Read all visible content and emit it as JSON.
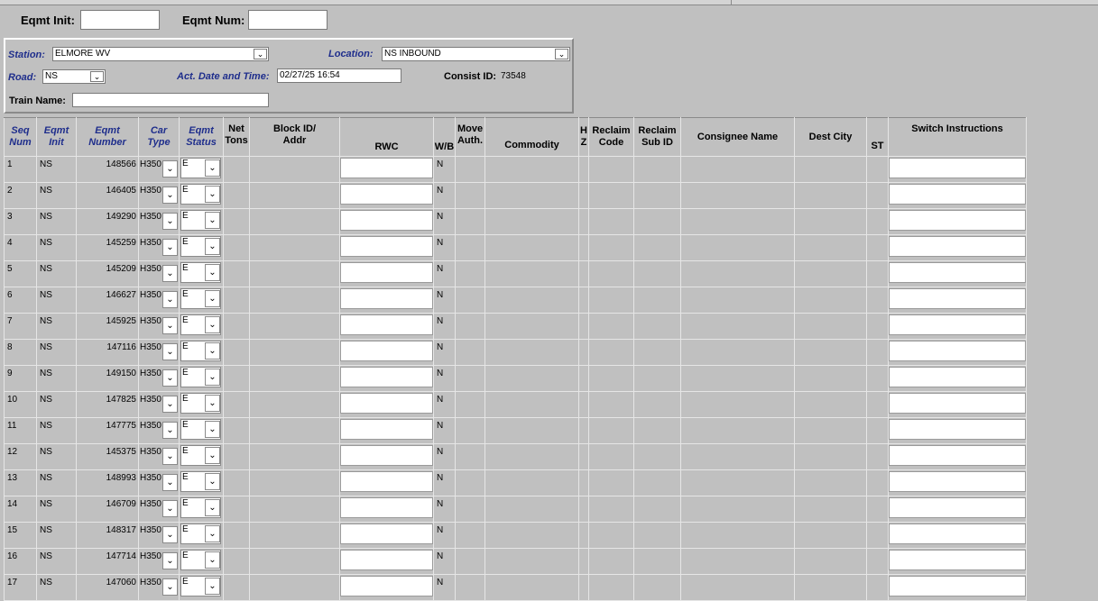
{
  "search": {
    "eqmt_init_label": "Eqmt Init:",
    "eqmt_init_value": "",
    "eqmt_num_label": "Eqmt Num:",
    "eqmt_num_value": ""
  },
  "header": {
    "station_label": "Station:",
    "station_value": "ELMORE WV",
    "location_label": "Location:",
    "location_value": "NS INBOUND",
    "road_label": "Road:",
    "road_value": "NS",
    "act_date_label": "Act. Date and Time:",
    "act_date_value": "02/27/25 16:54",
    "consist_label": "Consist ID:",
    "consist_value": "73548",
    "train_name_label": "Train Name:",
    "train_name_value": ""
  },
  "icons": {
    "dropdown": "chevron-down-icon",
    "glyph": "⌄"
  },
  "table": {
    "columns": {
      "seq": [
        "Seq",
        "Num"
      ],
      "init": [
        "Eqmt",
        "Init"
      ],
      "number": [
        "Eqmt",
        "Number"
      ],
      "cartype": [
        "Car",
        "Type"
      ],
      "status": [
        "Eqmt",
        "Status"
      ],
      "tons": [
        "Net",
        "Tons"
      ],
      "block": [
        "Block ID/",
        "Addr"
      ],
      "rwc": "RWC",
      "wb": "W/B",
      "move": [
        "Move",
        "Auth."
      ],
      "commodity": "Commodity",
      "hz": [
        "H",
        "Z"
      ],
      "rcode": [
        "Reclaim",
        "Code"
      ],
      "rsub": [
        "Reclaim",
        "Sub ID"
      ],
      "consignee": "Consignee Name",
      "dest": "Dest City",
      "st": "ST",
      "switch": "Switch Instructions"
    },
    "rows": [
      {
        "seq": "1",
        "init": "NS",
        "num": "148566",
        "type": "H350",
        "status": "E",
        "wb": "N"
      },
      {
        "seq": "2",
        "init": "NS",
        "num": "146405",
        "type": "H350",
        "status": "E",
        "wb": "N"
      },
      {
        "seq": "3",
        "init": "NS",
        "num": "149290",
        "type": "H350",
        "status": "E",
        "wb": "N"
      },
      {
        "seq": "4",
        "init": "NS",
        "num": "145259",
        "type": "H350",
        "status": "E",
        "wb": "N"
      },
      {
        "seq": "5",
        "init": "NS",
        "num": "145209",
        "type": "H350",
        "status": "E",
        "wb": "N"
      },
      {
        "seq": "6",
        "init": "NS",
        "num": "146627",
        "type": "H350",
        "status": "E",
        "wb": "N"
      },
      {
        "seq": "7",
        "init": "NS",
        "num": "145925",
        "type": "H350",
        "status": "E",
        "wb": "N"
      },
      {
        "seq": "8",
        "init": "NS",
        "num": "147116",
        "type": "H350",
        "status": "E",
        "wb": "N"
      },
      {
        "seq": "9",
        "init": "NS",
        "num": "149150",
        "type": "H350",
        "status": "E",
        "wb": "N"
      },
      {
        "seq": "10",
        "init": "NS",
        "num": "147825",
        "type": "H350",
        "status": "E",
        "wb": "N"
      },
      {
        "seq": "11",
        "init": "NS",
        "num": "147775",
        "type": "H350",
        "status": "E",
        "wb": "N"
      },
      {
        "seq": "12",
        "init": "NS",
        "num": "145375",
        "type": "H350",
        "status": "E",
        "wb": "N"
      },
      {
        "seq": "13",
        "init": "NS",
        "num": "148993",
        "type": "H350",
        "status": "E",
        "wb": "N"
      },
      {
        "seq": "14",
        "init": "NS",
        "num": "146709",
        "type": "H350",
        "status": "E",
        "wb": "N"
      },
      {
        "seq": "15",
        "init": "NS",
        "num": "148317",
        "type": "H350",
        "status": "E",
        "wb": "N"
      },
      {
        "seq": "16",
        "init": "NS",
        "num": "147714",
        "type": "H350",
        "status": "E",
        "wb": "N"
      },
      {
        "seq": "17",
        "init": "NS",
        "num": "147060",
        "type": "H350",
        "status": "E",
        "wb": "N"
      }
    ]
  }
}
